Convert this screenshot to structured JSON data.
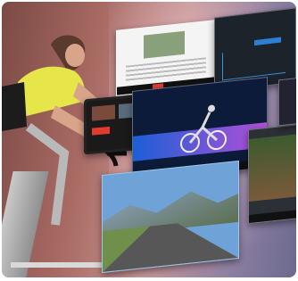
{
  "scene": {
    "subject": "indoor-cyclist-on-smart-trainer",
    "screens": [
      "web-page-panel",
      "dark-data-panel",
      "tablet-panel",
      "virtual-ride-panel",
      "mountain-road-panel",
      "side-video-panel"
    ]
  },
  "colors": {
    "accent": "#e23b2e",
    "jersey": "#e6e64a",
    "backdrop": "#a86a63"
  }
}
